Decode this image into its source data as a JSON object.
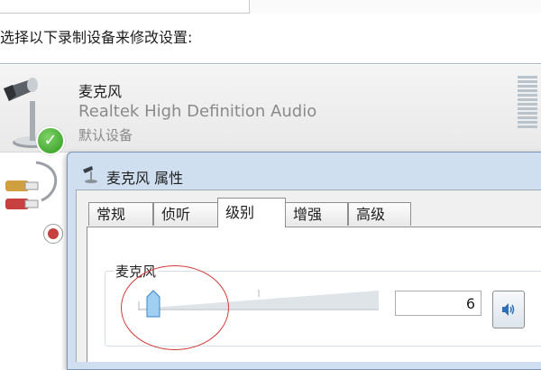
{
  "instruction": "选择以下录制设备来修改设置:",
  "devices": [
    {
      "name": "麦克风",
      "driver": "Realtek High Definition Audio",
      "status": "默认设备"
    }
  ],
  "dialog": {
    "title": "麦克风 属性",
    "tabs": [
      "常规",
      "侦听",
      "级别",
      "增强",
      "高级"
    ],
    "active_tab": "级别",
    "levels": {
      "group_label": "麦克风",
      "slider_value": "6"
    }
  },
  "colors": {
    "selected_row": "#ececec",
    "dialog_frame": "#cfdff0",
    "annotation_circle": "#d23a3a",
    "default_badge": "#2f9a1f"
  },
  "icons": [
    "microphone-icon",
    "check-icon",
    "line-in-jack-icon",
    "disabled-icon",
    "speaker-icon",
    "dialog-mic-icon"
  ]
}
